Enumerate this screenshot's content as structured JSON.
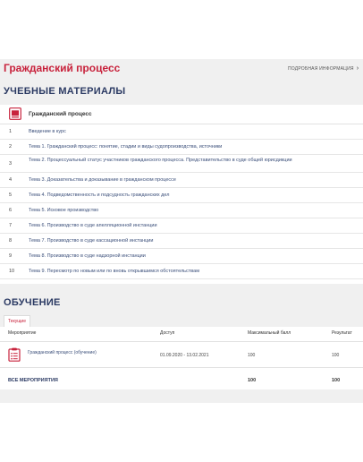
{
  "header": {
    "title": "Гражданский процесс",
    "more_label": "ПОДРОБНАЯ ИНФОРМАЦИЯ",
    "more_chevron": "›"
  },
  "materials": {
    "heading": "УЧЕБНЫЕ МАТЕРИАЛЫ",
    "course_title": "Гражданский процесс",
    "items": [
      {
        "num": "1",
        "text": "Введение в курс"
      },
      {
        "num": "2",
        "text": "Тема 1. Гражданский процесс: понятие, стадии и виды судопроизводства, источники"
      },
      {
        "num": "3",
        "text": "Тема 2. Процессуальный статус участников гражданского процесса. Представительство в суде общей юрисдикции"
      },
      {
        "num": "4",
        "text": "Тема 3. Доказательства и доказывание в гражданском процессе"
      },
      {
        "num": "5",
        "text": "Тема 4. Подведомственность и подсудность гражданских дел"
      },
      {
        "num": "6",
        "text": "Тема 5. Исковое производство"
      },
      {
        "num": "7",
        "text": "Тема 6. Производство в суде апелляционной инстанции"
      },
      {
        "num": "8",
        "text": "Тема 7. Производство в суде кассационной инстанции"
      },
      {
        "num": "9",
        "text": "Тема 8. Производство в суде надзорной инстанции"
      },
      {
        "num": "10",
        "text": "Тема 9. Пересмотр по новым или по вновь открывшимся обстоятельствам"
      }
    ]
  },
  "training": {
    "heading": "ОБУЧЕНИЕ",
    "tab_current": "Текущие",
    "columns": {
      "event": "Мероприятие",
      "access": "Доступ",
      "max_score": "Максимальный балл",
      "result": "Результат"
    },
    "rows": [
      {
        "event": "Гражданский процесс (обучение)",
        "access": "01.09.2020 - 13.02.2021",
        "max_score": "100",
        "result": "100"
      }
    ],
    "total": {
      "label": "ВСЕ МЕРОПРИЯТИЯ",
      "max_score": "100",
      "result": "100"
    }
  },
  "colors": {
    "accent": "#c8223c",
    "heading": "#2b3a63",
    "link": "#3b4f7a",
    "background": "#f0f0f0"
  },
  "icons": {
    "course": "book-icon",
    "event": "clipboard-icon",
    "more": "chevron-right-icon"
  }
}
